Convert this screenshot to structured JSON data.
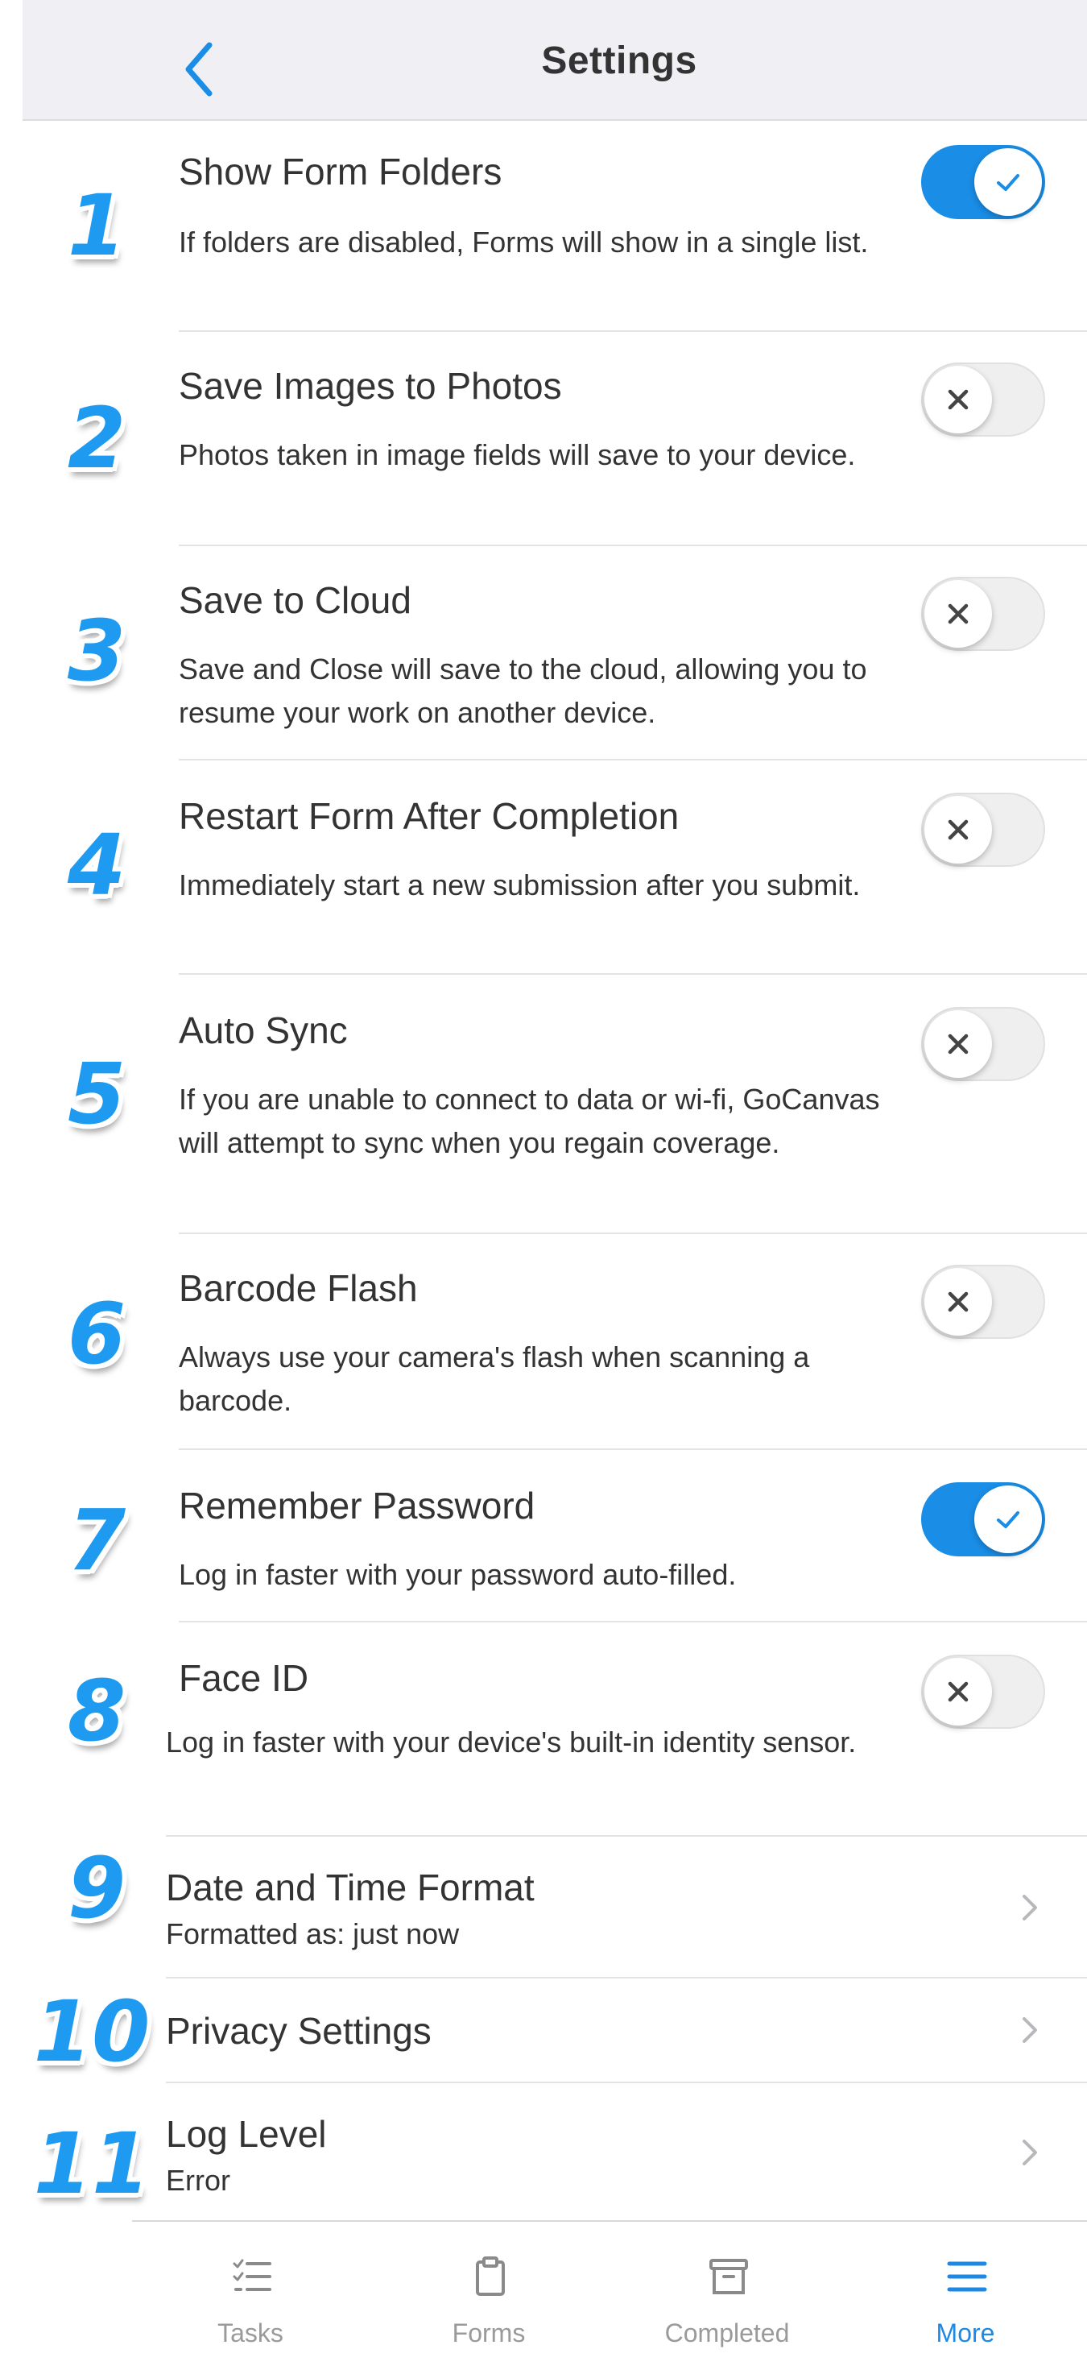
{
  "header": {
    "title": "Settings",
    "back_icon": "chevron-left-icon"
  },
  "settings": [
    {
      "num": "1",
      "title": "Show Form Folders",
      "desc": "If folders are disabled, Forms will show in a single list.",
      "state": "on"
    },
    {
      "num": "2",
      "title": "Save Images to Photos",
      "desc": "Photos taken in image fields will save to your device.",
      "state": "off"
    },
    {
      "num": "3",
      "title": "Save to Cloud",
      "desc": "Save and Close will save to the cloud, allowing you to resume your work on another device.",
      "state": "off"
    },
    {
      "num": "4",
      "title": "Restart Form After Completion",
      "desc": "Immediately start a new submission after you submit.",
      "state": "off"
    },
    {
      "num": "5",
      "title": "Auto Sync",
      "desc": "If you are unable to connect to data or wi-fi, GoCanvas will attempt to sync when you regain coverage.",
      "state": "off"
    },
    {
      "num": "6",
      "title": "Barcode Flash",
      "desc": "Always use your camera's flash when scanning a barcode.",
      "state": "off"
    },
    {
      "num": "7",
      "title": "Remember Password",
      "desc": "Log in faster with your password auto-filled.",
      "state": "on"
    },
    {
      "num": "8",
      "title": "Face ID",
      "desc": "Log in faster with your device's built-in identity sensor.",
      "state": "off"
    }
  ],
  "nav_rows": [
    {
      "num": "9",
      "title": "Date and Time Format",
      "subtitle": "Formatted as: just now"
    },
    {
      "num": "10",
      "title": "Privacy Settings",
      "subtitle": ""
    },
    {
      "num": "11",
      "title": "Log Level",
      "subtitle": "Error"
    }
  ],
  "tabbar": {
    "tabs": [
      {
        "label": "Tasks",
        "icon": "tasks-list-icon",
        "active": false
      },
      {
        "label": "Forms",
        "icon": "clipboard-icon",
        "active": false
      },
      {
        "label": "Completed",
        "icon": "archive-box-icon",
        "active": false
      },
      {
        "label": "More",
        "icon": "hamburger-menu-icon",
        "active": true
      }
    ]
  },
  "colors": {
    "accent": "#1a8de6",
    "number": "#1e9bf0",
    "toggle_off": "#efefef",
    "header_bg": "#efeff4"
  }
}
